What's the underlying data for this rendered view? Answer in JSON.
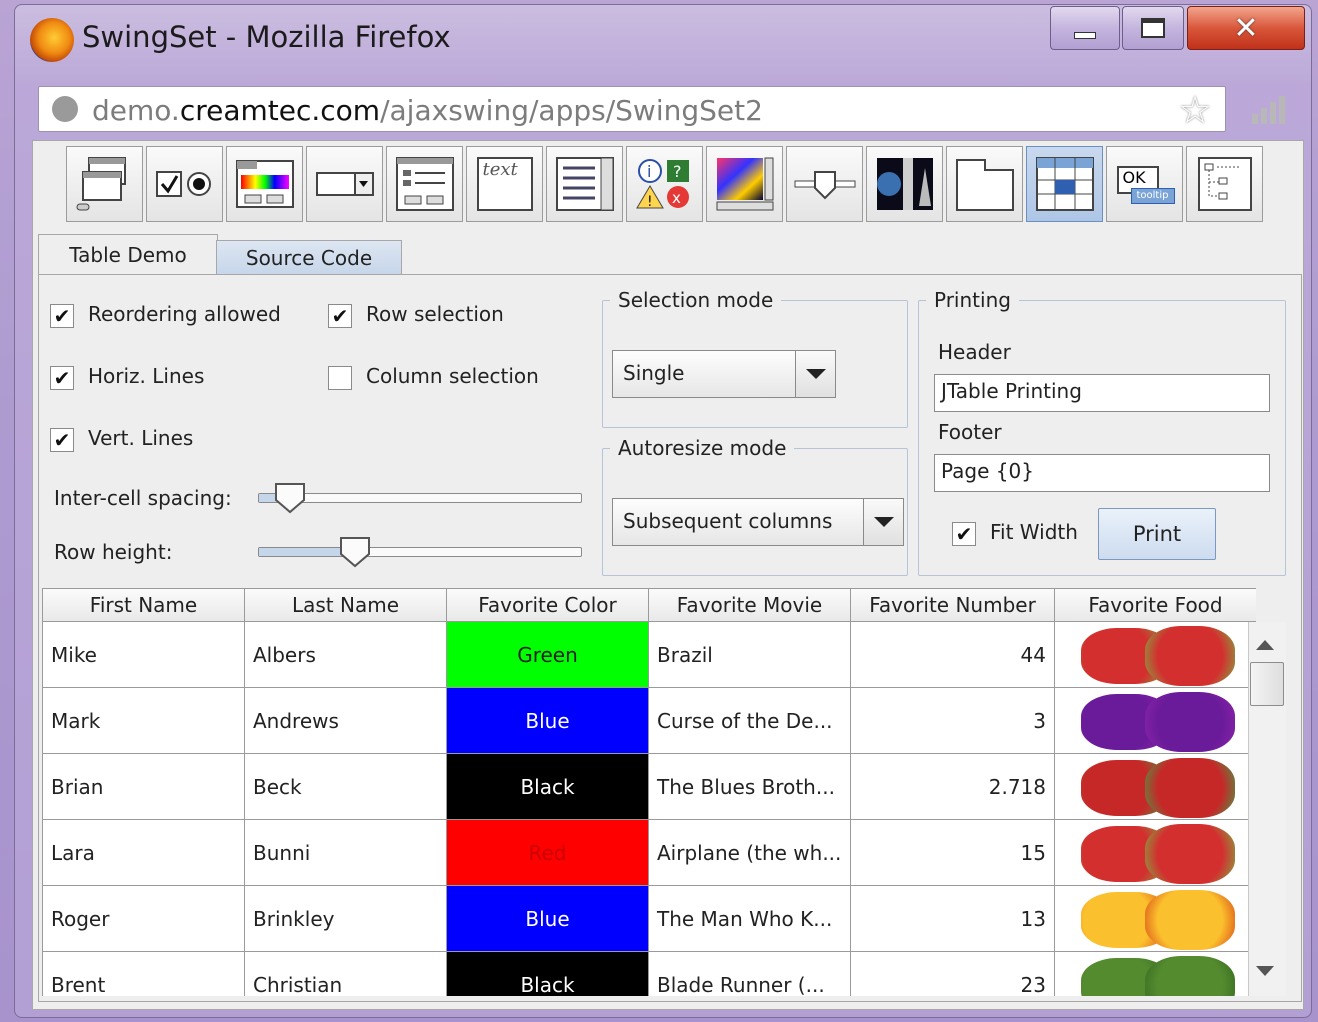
{
  "window": {
    "title": "SwingSet - Mozilla Firefox"
  },
  "address_bar": {
    "url_prefix": "demo.",
    "url_domain": "creamtec.com",
    "url_path": "/ajaxswing/apps/SwingSet2"
  },
  "toolbar": {
    "items": [
      "internal-frame-demo",
      "button-demo",
      "color-chooser-demo",
      "combobox-demo",
      "file-chooser-demo",
      "html-demo",
      "list-demo",
      "option-pane-demo",
      "progress-bar-demo",
      "slider-demo",
      "split-pane-demo",
      "tabbed-pane-demo",
      "table-demo",
      "tooltip-demo",
      "tree-demo"
    ],
    "html_icon_text": "text",
    "tooltip_icon_text": "OK",
    "tooltip_icon_sub": "tooltip"
  },
  "tabs": [
    {
      "label": "Table Demo",
      "selected": true
    },
    {
      "label": "Source Code",
      "selected": false
    }
  ],
  "options": {
    "reordering": {
      "label": "Reordering allowed",
      "checked": true
    },
    "horiz_lines": {
      "label": "Horiz. Lines",
      "checked": true
    },
    "vert_lines": {
      "label": "Vert. Lines",
      "checked": true
    },
    "row_selection": {
      "label": "Row selection",
      "checked": true
    },
    "column_selection": {
      "label": "Column selection",
      "checked": false
    },
    "inter_cell_spacing": {
      "label": "Inter-cell spacing:",
      "level": 0.1
    },
    "row_height": {
      "label": "Row height:",
      "level": 0.3
    },
    "check_mark": "✔"
  },
  "selection_mode": {
    "title": "Selection mode",
    "value": "Single"
  },
  "autoresize_mode": {
    "title": "Autoresize mode",
    "value": "Subsequent columns"
  },
  "printing": {
    "title": "Printing",
    "header_label": "Header",
    "header_value": "JTable Printing",
    "footer_label": "Footer",
    "footer_value": "Page {0}",
    "fit_width": {
      "label": "Fit Width",
      "checked": true
    },
    "print_label": "Print"
  },
  "table": {
    "columns": [
      "First Name",
      "Last Name",
      "Favorite Color",
      "Favorite Movie",
      "Favorite Number",
      "Favorite Food"
    ],
    "rows": [
      {
        "first": "Mike",
        "last": "Albers",
        "color": "Green",
        "color_hex": "#00ff00",
        "color_text": "#222222",
        "movie": "Brazil",
        "number": "44",
        "food": "strawberry"
      },
      {
        "first": "Mark",
        "last": "Andrews",
        "color": "Blue",
        "color_hex": "#0000ff",
        "color_text": "#ffffff",
        "movie": "Curse of the De...",
        "number": "3",
        "food": "grapes"
      },
      {
        "first": "Brian",
        "last": "Beck",
        "color": "Black",
        "color_hex": "#000000",
        "color_text": "#ffffff",
        "movie": "The Blues Broth...",
        "number": "2.718",
        "food": "raspberry"
      },
      {
        "first": "Lara",
        "last": "Bunni",
        "color": "Red",
        "color_hex": "#ff0000",
        "color_text": "#cc0000",
        "movie": "Airplane (the wh...",
        "number": "15",
        "food": "strawberry"
      },
      {
        "first": "Roger",
        "last": "Brinkley",
        "color": "Blue",
        "color_hex": "#0000ff",
        "color_text": "#ffffff",
        "movie": "The Man Who K...",
        "number": "13",
        "food": "peach"
      },
      {
        "first": "Brent",
        "last": "Christian",
        "color": "Black",
        "color_hex": "#000000",
        "color_text": "#ffffff",
        "movie": "Blade Runner (...",
        "number": "23",
        "food": "broccoli"
      }
    ]
  },
  "colors": {
    "accent": "#c5d5ea",
    "selected_tool": "#aec6e6"
  }
}
